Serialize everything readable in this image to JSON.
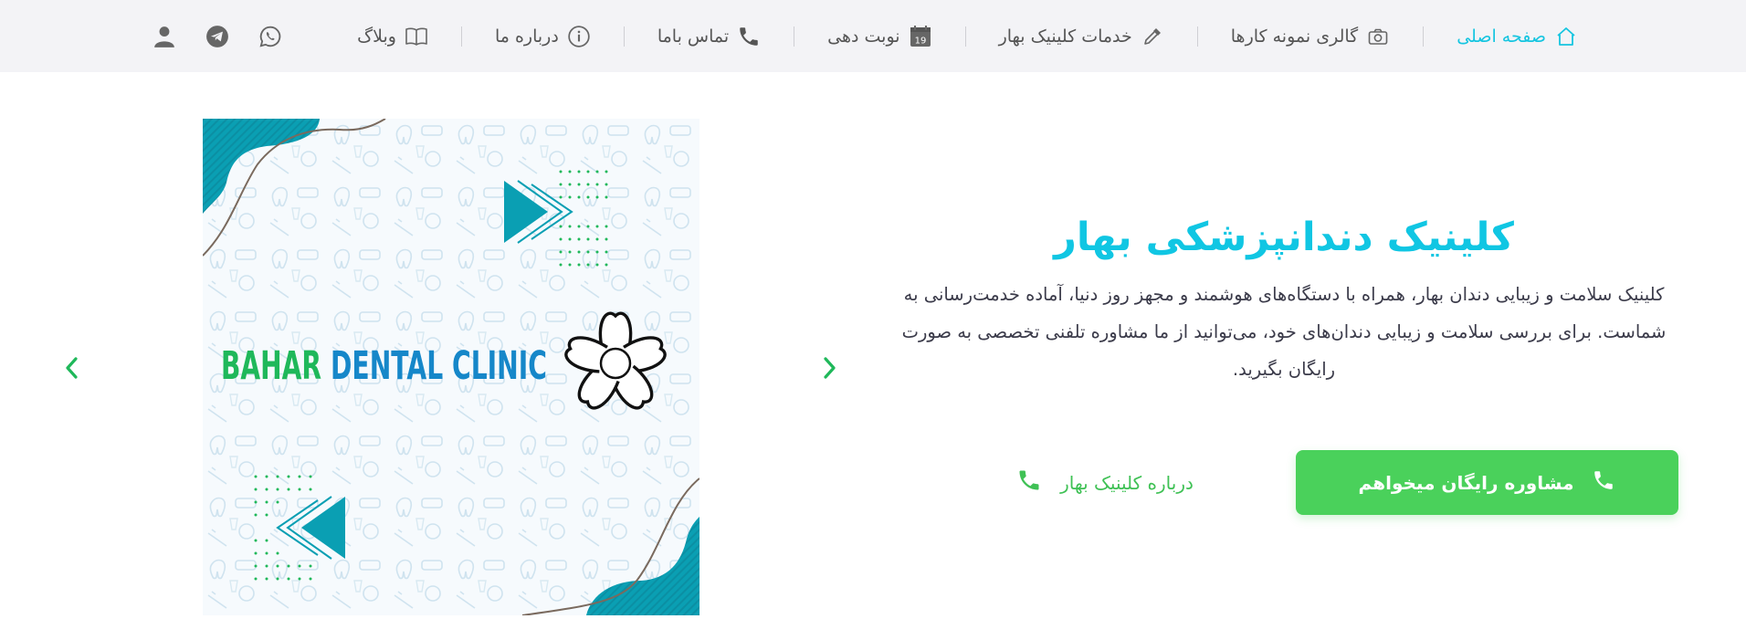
{
  "nav": {
    "items": [
      {
        "label": "صفحه اصلی",
        "icon": "home-icon",
        "active": true
      },
      {
        "label": "گالری نمونه کارها",
        "icon": "camera-icon"
      },
      {
        "label": "خدمات کلینیک بهار",
        "icon": "dropper-icon"
      },
      {
        "label": "نوبت دهی",
        "icon": "calendar-icon",
        "badge": "19"
      },
      {
        "label": "تماس باما",
        "icon": "phone-icon"
      },
      {
        "label": "درباره ما",
        "icon": "info-icon"
      },
      {
        "label": "وبلاگ",
        "icon": "book-icon"
      }
    ],
    "social": [
      "whatsapp-icon",
      "telegram-icon",
      "user-icon"
    ]
  },
  "hero": {
    "title": "کلینیک دندانپزشکی بهار",
    "description": "کلینیک سلامت و زیبایی دندان بهار، همراه با دستگاه‌های هوشمند و مجهز روز دنیا، آماده خدمت‌رسانی به شماست. برای بررسی سلامت و زیبایی دندان‌های خود، می‌توانید از ما مشاوره تلفنی تخصصی به صورت رایگان بگیرید.",
    "primary_button": "مشاوره رایگان میخواهم",
    "secondary_button": "درباره کلینیک بهار",
    "logo_word1": "BAHAR",
    "logo_word2": "DENTAL CLINIC"
  },
  "colors": {
    "accent": "#15c5e0",
    "green": "#4ad15b",
    "teal": "#0a9fb3",
    "logo_green": "#1fb85a",
    "logo_blue": "#1687c9"
  }
}
